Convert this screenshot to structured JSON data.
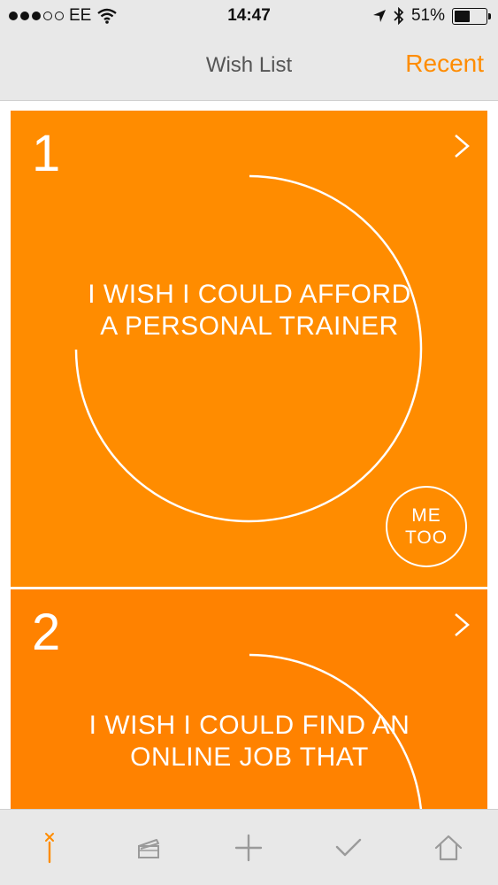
{
  "status_bar": {
    "carrier": "EE",
    "time": "14:47",
    "battery": "51%",
    "battery_level": 0.51,
    "signal_bars_filled": 3,
    "signal_bars_total": 5,
    "icons": [
      "wifi-icon",
      "location-arrow-icon",
      "bluetooth-icon",
      "battery-icon"
    ]
  },
  "nav": {
    "title": "Wish List",
    "recent": "Recent"
  },
  "wishes": [
    {
      "rank": "1",
      "text": "I WISH I COULD AFFORD A PERSONAL TRAINER",
      "me_too": "ME TOO"
    },
    {
      "rank": "2",
      "text": "I WISH I COULD FIND AN ONLINE JOB THAT"
    }
  ],
  "tabs": [
    {
      "name": "wish-wand",
      "icon": "wand-icon",
      "active": true
    },
    {
      "name": "clapper",
      "icon": "clapperboard-icon",
      "active": false
    },
    {
      "name": "add",
      "icon": "plus-icon",
      "active": false
    },
    {
      "name": "granted",
      "icon": "checkmark-icon",
      "active": false
    },
    {
      "name": "home",
      "icon": "home-icon",
      "active": false
    }
  ],
  "colors": {
    "accent": "#ff8c00",
    "card_1": "#ff8c00",
    "card_2": "#ff8200",
    "bar_bg": "#e8e8e8",
    "tab_icon": "#9a9a9a"
  }
}
